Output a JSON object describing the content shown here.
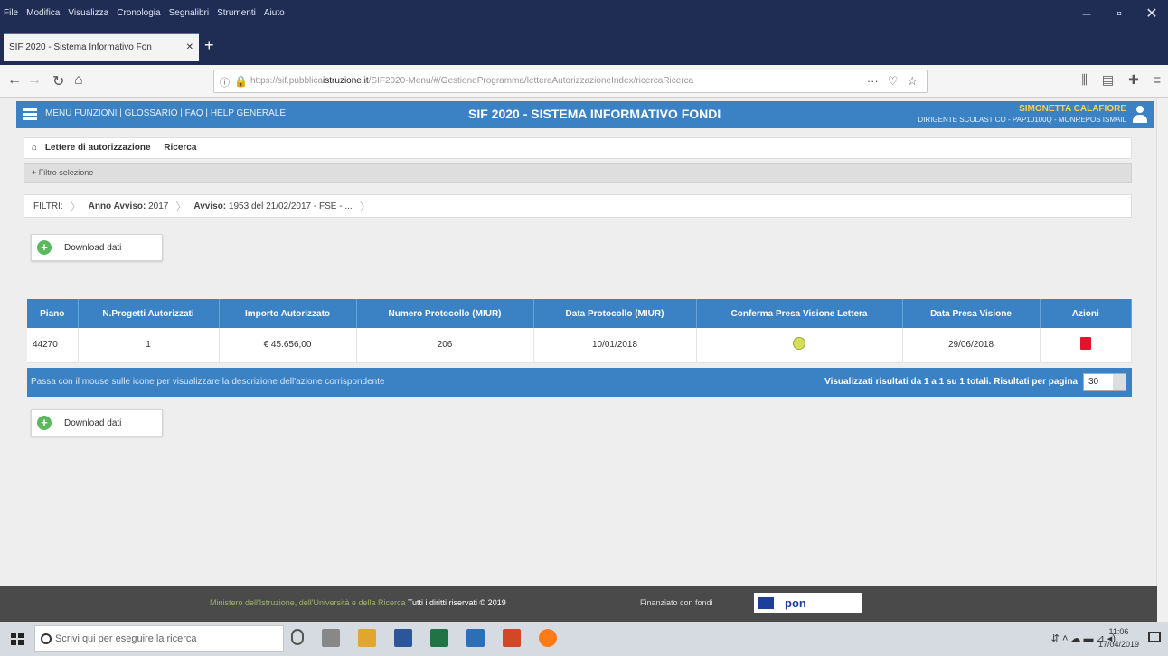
{
  "browser": {
    "menu": [
      "File",
      "Modifica",
      "Visualizza",
      "Cronologia",
      "Segnalibri",
      "Strumenti",
      "Aiuto"
    ],
    "tab_title": "SIF 2020 - Sistema Informativo Fon",
    "url_prefix": "https://sif.pubblica",
    "url_domain": "istruzione.it",
    "url_rest": "/SIF2020-Menu/#/GestioneProgramma/letteraAutorizzazioneIndex/ricercaRicerca"
  },
  "app": {
    "menu_text": "MENÙ FUNZIONI | GLOSSARIO | FAQ | HELP GENERALE",
    "title": "SIF 2020 - SISTEMA INFORMATIVO FONDI",
    "user_name": "SIMONETTA CALAFIORE",
    "user_role": "DIRIGENTE SCOLASTICO - PAP10100Q - MONREPOS ISMAIL"
  },
  "breadcrumb": {
    "section": "Lettere di autorizzazione",
    "page": "Ricerca"
  },
  "filter_toggle": "+ Filtro selezione",
  "filters": {
    "label": "FILTRI:",
    "anno_label": "Anno Avviso:",
    "anno_value": "2017",
    "avviso_label": "Avviso:",
    "avviso_value": "1953 del 21/02/2017 - FSE - ..."
  },
  "download_label": "Download dati",
  "table": {
    "headers": [
      "Piano",
      "N.Progetti Autorizzati",
      "Importo Autorizzato",
      "Numero Protocollo (MIUR)",
      "Data Protocollo (MIUR)",
      "Conferma Presa Visione Lettera",
      "Data Presa Visione",
      "Azioni"
    ],
    "rows": [
      {
        "piano": "44270",
        "n_progetti": "1",
        "importo": "€ 45.656,00",
        "numero_protocollo": "206",
        "data_protocollo": "10/01/2018",
        "data_presa_visione": "29/06/2018"
      }
    ]
  },
  "grid_footer": {
    "hint": "Passa con il mouse sulle icone per visualizzare la descrizione dell'azione corrispondente",
    "count": "Visualizzati risultati da 1 a 1 su 1 totali. Risultati per pagina",
    "per_page": "30"
  },
  "footer": {
    "ministry": "Ministero dell'Istruzione, dell'Università e della Ricerca",
    "rights": "Tutti i diritti riservati © 2019",
    "financed": "Finanziato con fondi",
    "pon": "pon"
  },
  "taskbar": {
    "search_placeholder": "Scrivi qui per eseguire la ricerca",
    "time": "11:06",
    "date": "17/04/2019"
  }
}
